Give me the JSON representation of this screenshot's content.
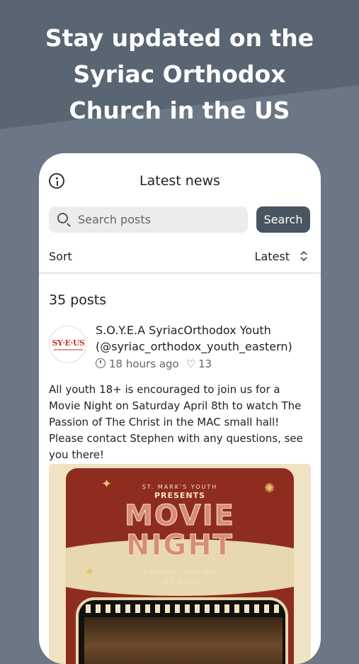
{
  "hero": {
    "lines": [
      "Stay updated on the",
      "Syriac Orthodox",
      "Church in the US"
    ]
  },
  "header": {
    "title": "Latest news",
    "info_icon": "info-circle-icon"
  },
  "search": {
    "placeholder": "Search posts",
    "button_label": "Search",
    "icon": "search-icon"
  },
  "sort": {
    "label": "Sort",
    "value": "Latest",
    "icon": "chevron-up-down-icon"
  },
  "feed": {
    "count_label": "35 posts"
  },
  "post": {
    "avatar_text": "SY·E·US",
    "author_line1": "S.O.Y.E.A SyriacOrthodox Youth",
    "author_line2": "(@syriac_orthodox_youth_eastern)",
    "time": "18 hours ago",
    "likes": "13",
    "body_lines": [
      "All youth 18+ is encouraged to join us for a",
      "Movie Night on Saturday April 8th to watch The",
      "Passion of The Christ in the MAC small hall!",
      "Please contact Stephen with any questions, see",
      "you there!"
    ],
    "image": {
      "subtitle": "ST. MARK'S YOUTH",
      "presents": "PRESENTS",
      "title_line1": "MOVIE",
      "title_line2": "NIGHT",
      "date": "Saturday, April 8th",
      "time": "@7:30pm"
    }
  },
  "colors": {
    "background": "#6b7785",
    "button": "#4a5562",
    "poster": "#8e2d1f",
    "poster_accent": "#e7d8ad"
  }
}
